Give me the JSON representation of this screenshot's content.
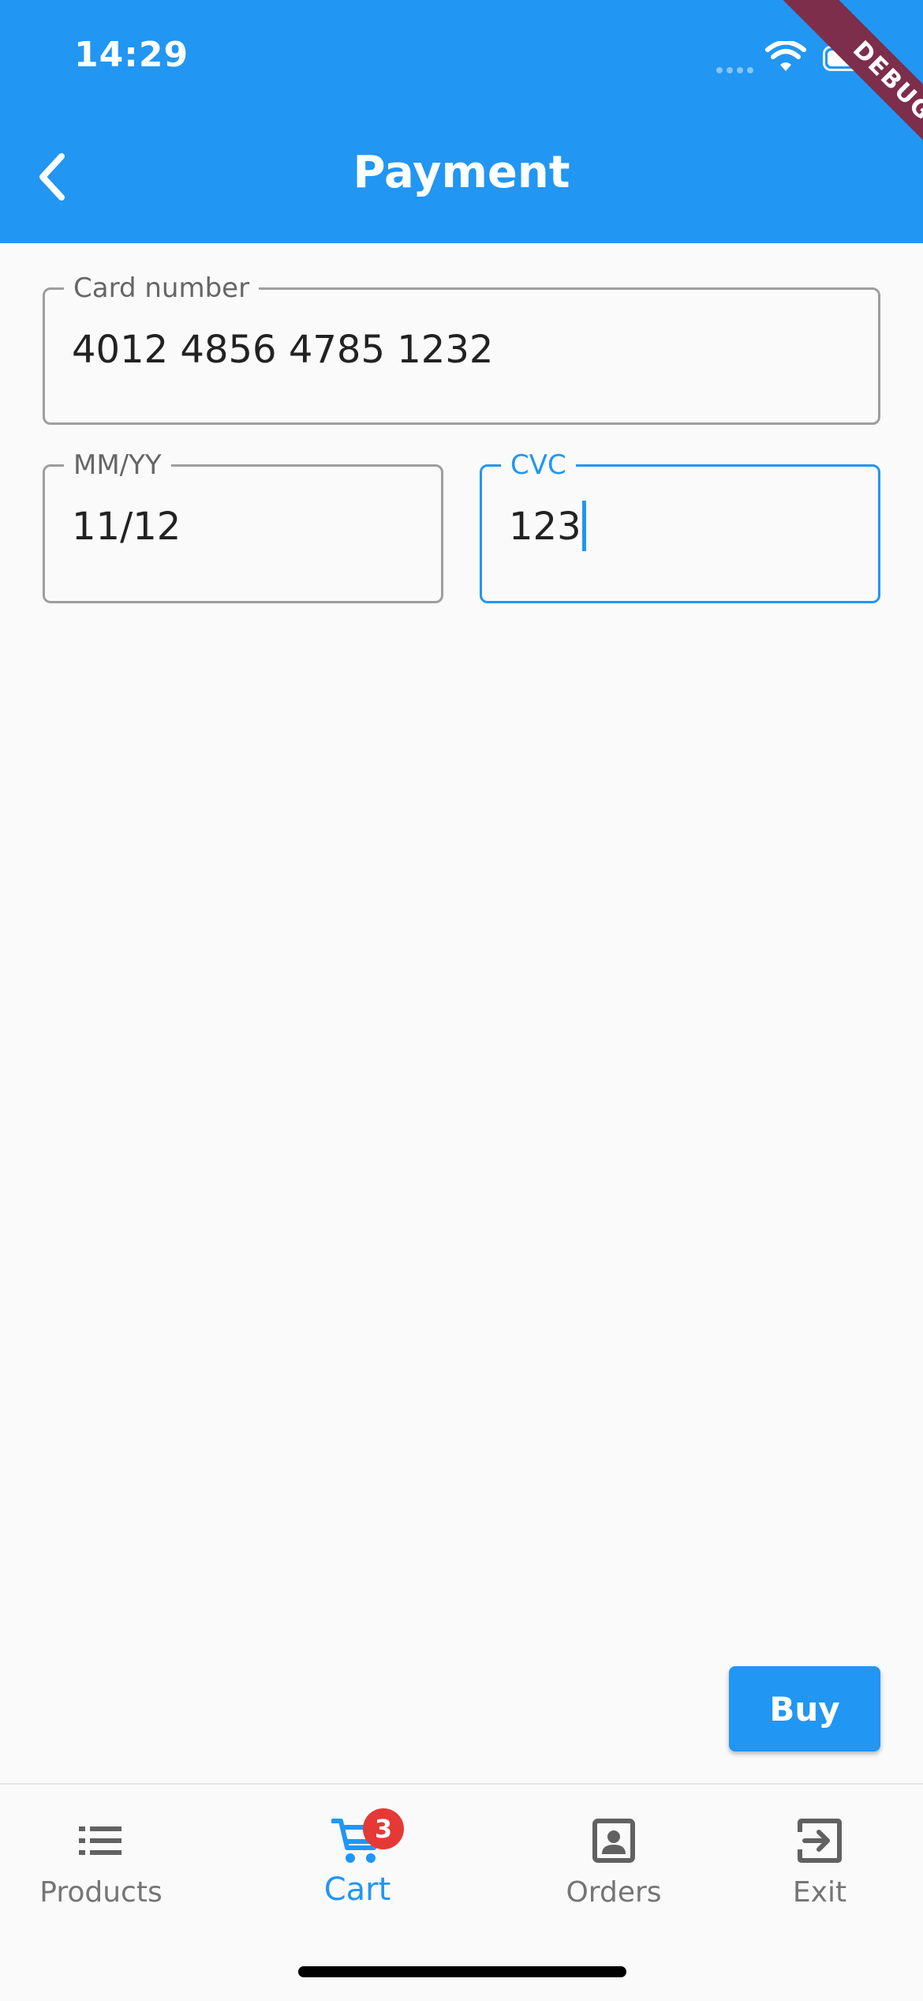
{
  "status_bar": {
    "time": "14:29"
  },
  "debug_banner": "DEBUG",
  "app_bar": {
    "title": "Payment"
  },
  "form": {
    "card_number": {
      "label": "Card number",
      "value": "4012 4856 4785 1232"
    },
    "expiry": {
      "label": "MM/YY",
      "value": "11/12"
    },
    "cvc": {
      "label": "CVC",
      "value": "123",
      "focused": true
    }
  },
  "buy_button": {
    "label": "Buy"
  },
  "bottom_nav": {
    "items": [
      {
        "label": "Products",
        "icon": "list-icon",
        "active": false
      },
      {
        "label": "Cart",
        "icon": "shopping-cart-icon",
        "active": true,
        "badge": "3"
      },
      {
        "label": "Orders",
        "icon": "portrait-icon",
        "active": false
      },
      {
        "label": "Exit",
        "icon": "exit-icon",
        "active": false
      }
    ]
  },
  "colors": {
    "primary": "#2196F3",
    "background": "#FAFAFA",
    "badge": "#E53935",
    "debug_ribbon": "#7D2E4A",
    "inactive": "#757575"
  }
}
